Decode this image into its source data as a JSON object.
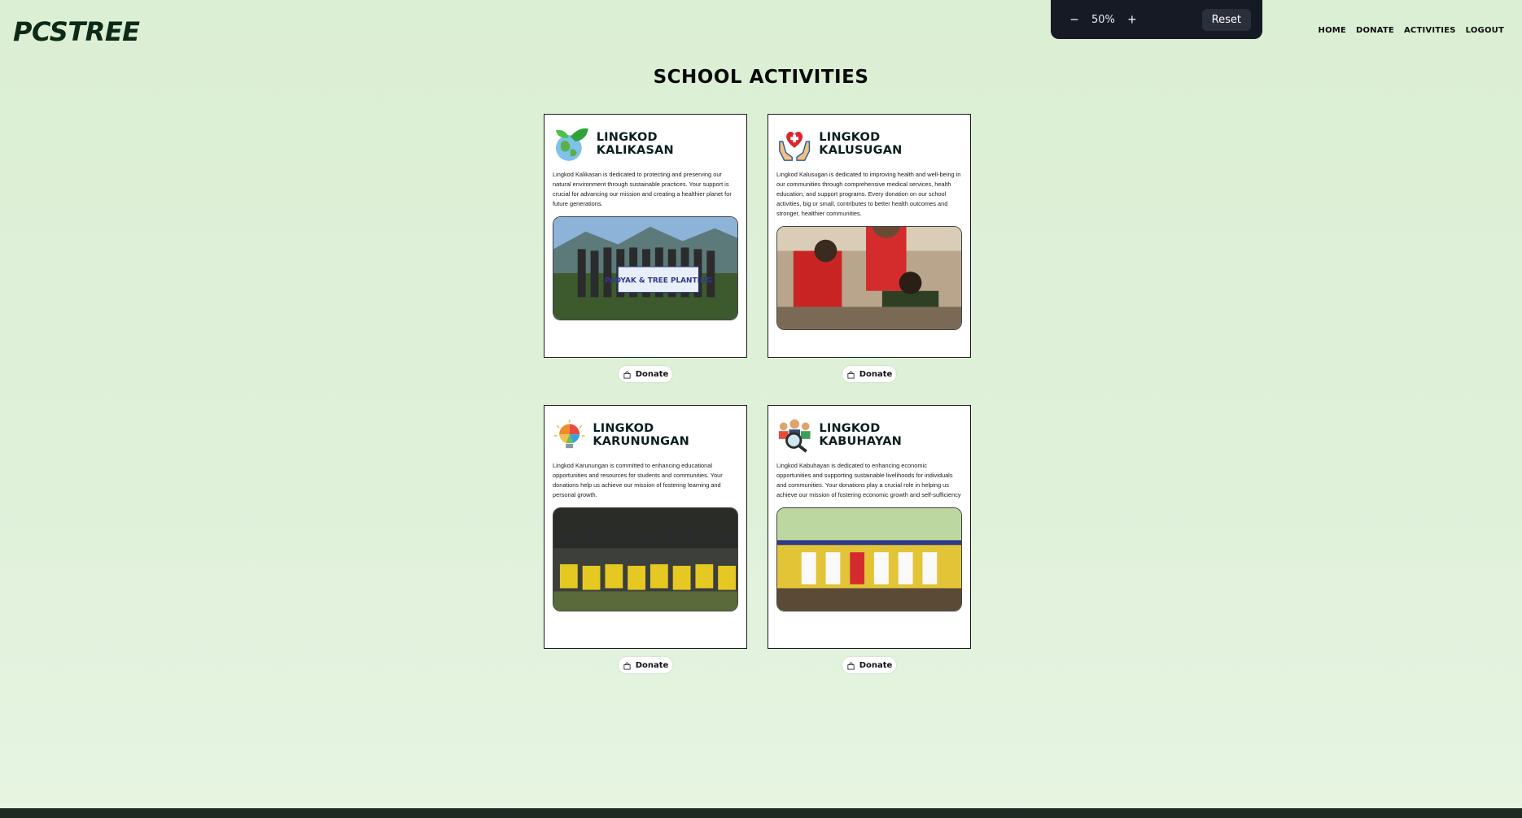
{
  "brand": {
    "name": "PCSTREE"
  },
  "zoom": {
    "minus": "−",
    "value": "50%",
    "plus": "+",
    "reset": "Reset"
  },
  "nav": {
    "items": [
      "HOME",
      "DONATE",
      "ACTIVITIES",
      "LOGOUT"
    ]
  },
  "page": {
    "title": "SCHOOL ACTIVITIES"
  },
  "activities": [
    {
      "title": "LINGKOD KALIKASAN",
      "icon": "earth-leaf-icon",
      "description": "Lingkod Kalikasan is dedicated to protecting and preserving our natural environment through sustainable practices. Your support is crucial for advancing our mission and creating a healthier planet for future generations.",
      "photo": "tree-planting-photo",
      "banner": "PADYAK & TREE PLANTING",
      "donate": "Donate"
    },
    {
      "title": "LINGKOD KALUSUGAN",
      "icon": "heart-hands-icon",
      "description": "Lingkod Kalusugan is dedicated to improving health and well-being in our communities through comprehensive medical services, health education, and support programs. Every donation on our school activities, big or small, contributes to better health outcomes and stronger, healthier communities.",
      "photo": "health-service-photo",
      "donate": "Donate"
    },
    {
      "title": "LINGKOD KARUNUNGAN",
      "icon": "lightbulb-icon",
      "description": "Lingkod Karunungan is committed to enhancing educational opportunities and resources for students and communities. Your donations help us achieve our mission of fostering learning and personal growth.",
      "photo": "students-photo",
      "donate": "Donate"
    },
    {
      "title": "LINGKOD KABUHAYAN",
      "icon": "people-magnifier-icon",
      "description": "Lingkod Kabuhayan is dedicated to enhancing economic opportunities and supporting sustainable livelihoods for individuals and communities. Your donations play a crucial role in helping us achieve our mission of fostering economic growth and self-sufficiency",
      "photo": "livelihood-photo",
      "donate": "Donate"
    }
  ]
}
